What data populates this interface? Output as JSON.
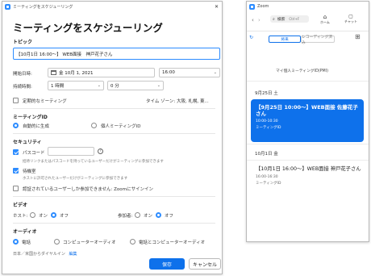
{
  "schedule_window": {
    "title": "ミーティングをスケジューリング",
    "heading": "ミーティングをスケジューリング",
    "topic": {
      "label": "トピック",
      "value": "【10月1日 16:00～】 WEB面接　神戸花子さん"
    },
    "start": {
      "label": "開始日時:",
      "date": "金  10月  1, 2021",
      "time": "16:00"
    },
    "duration": {
      "label": "持続時間:",
      "hours": "1 時間",
      "minutes": "0 分"
    },
    "recurring": {
      "label": "定期的なミーティング",
      "timezone": "タイム ゾーン: 大阪, 札幌, 東..."
    },
    "meeting_id": {
      "section": "ミーティングID",
      "auto": "自動的に生成",
      "personal": "個人ミーティングID"
    },
    "security": {
      "section": "セキュリティ",
      "passcode_label": "パスコード",
      "passcode_help": "?",
      "passcode_hint": "招待リンクまたはパスコードを持っているユーザーだけがミーティングに参加できます",
      "waiting_label": "待機室",
      "waiting_hint": "ホストに許可されたユーザーだけがミーティングに参加できます",
      "auth_label": "認証されているユーザーしか参加できません: Zoomにサインイン"
    },
    "video": {
      "section": "ビデオ",
      "host": "ホスト:",
      "participants": "参加者:",
      "on": "オン",
      "off": "オフ"
    },
    "audio": {
      "section": "オーディオ",
      "phone": "電話",
      "computer": "コンピューターオーディオ",
      "both": "電話とコンピューターオーディオ",
      "dial_in": "日本／米国からダイヤルイン",
      "edit": "編集"
    },
    "save": "保存",
    "cancel": "キャンセル"
  },
  "zoom_window": {
    "title": "Zoom",
    "search": "検索",
    "shortcut": "Ctrl+F",
    "nav_home": "ホーム",
    "nav_chat": "チャット",
    "tab_upcoming": "将来",
    "tab_recorded": "レコーディング済み",
    "personal_meeting": "マイ個人ミーティングID(PMI)",
    "date_group_1": "9月25日 土",
    "meeting_1": {
      "title": "【9月25日 10:00～】WEB面接  佐藤花子さん",
      "time": "10:00-10:30",
      "id": "ミーティングID"
    },
    "date_group_2": "10月1日 金",
    "meeting_2": {
      "title": "【10月1日 16:00～】WEB面接  神戸花子さん",
      "time": "16:00-16:30",
      "id": "ミーティングID"
    },
    "colors": {
      "accent": "#0e71eb"
    }
  }
}
